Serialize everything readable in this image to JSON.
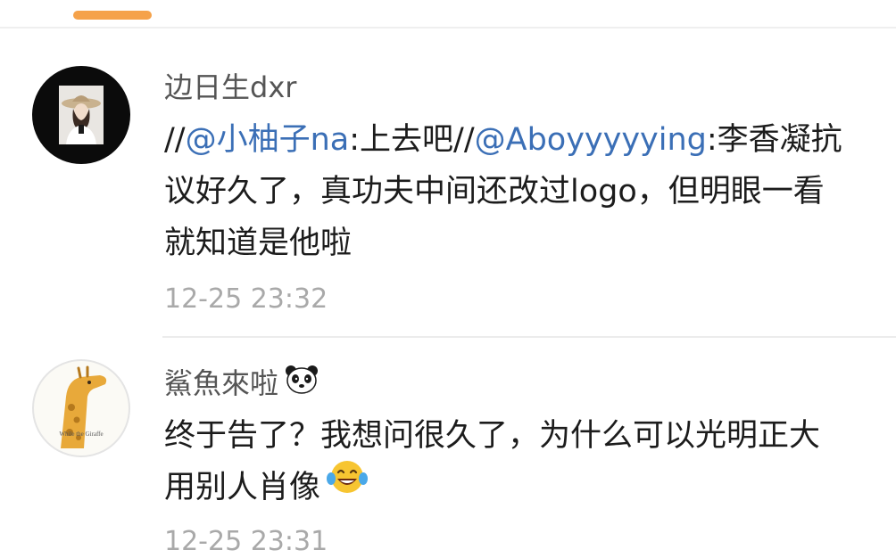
{
  "comments": [
    {
      "username": "边日生dxr",
      "text": {
        "prefix": "//",
        "mention_1": "@小柚子na",
        "part_1": ":上去吧//",
        "mention_2": "@Aboyyyyying",
        "part_2": ":李香凝抗",
        "line_2": "议好久了，真功夫中间还改过logo，但明眼一看",
        "line_3": "就知道是他啦"
      },
      "timestamp": "12-25 23:32",
      "avatar_icon": "profile-photo-icon"
    },
    {
      "username": "鯊魚來啦",
      "username_emoji": "panda-icon",
      "text": {
        "line_1": "终于告了？我想问很久了，为什么可以光明正大",
        "line_2": "用别人肖像",
        "line_2_emoji": "laughing-tears-icon"
      },
      "timestamp": "12-25 23:31",
      "avatar_icon": "giraffe-icon",
      "avatar_caption": "While the Giraffe"
    }
  ],
  "colors": {
    "tab_indicator": "#f5a24a",
    "mention": "#3b6fb6",
    "username": "#555555",
    "timestamp": "#a9a9a9",
    "text": "#1c1c1c"
  }
}
